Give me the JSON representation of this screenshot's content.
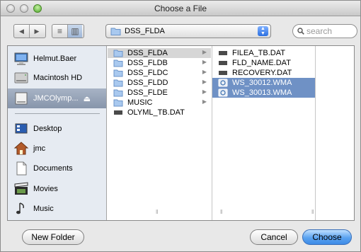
{
  "window": {
    "title": "Choose a File"
  },
  "toolbar": {
    "back_arrow": "◀",
    "forward_arrow": "▶",
    "view_list": "≡",
    "view_columns": "▥",
    "path_label": "DSS_FLDA",
    "search_placeholder": "search"
  },
  "sidebar": {
    "items": [
      {
        "label": "Helmut.Baer",
        "icon": "computer-icon"
      },
      {
        "label": "Macintosh HD",
        "icon": "hard-drive-icon"
      },
      {
        "label": "JMCOlymp...",
        "icon": "drive-icon",
        "eject": "⏏"
      },
      {
        "label": "Desktop",
        "icon": "desktop-icon"
      },
      {
        "label": "jmc",
        "icon": "home-icon"
      },
      {
        "label": "Documents",
        "icon": "documents-icon"
      },
      {
        "label": "Movies",
        "icon": "movies-icon"
      },
      {
        "label": "Music",
        "icon": "music-icon"
      }
    ]
  },
  "columns": {
    "col1": [
      {
        "label": "DSS_FLDA",
        "type": "folder",
        "arrow": "▶"
      },
      {
        "label": "DSS_FLDB",
        "type": "folder",
        "arrow": "▶"
      },
      {
        "label": "DSS_FLDC",
        "type": "folder",
        "arrow": "▶"
      },
      {
        "label": "DSS_FLDD",
        "type": "folder",
        "arrow": "▶"
      },
      {
        "label": "DSS_FLDE",
        "type": "folder",
        "arrow": "▶"
      },
      {
        "label": "MUSIC",
        "type": "folder",
        "arrow": "▶"
      },
      {
        "label": "OLYML_TB.DAT",
        "type": "file"
      }
    ],
    "col2": [
      {
        "label": "FILEA_TB.DAT",
        "type": "file"
      },
      {
        "label": "FLD_NAME.DAT",
        "type": "file"
      },
      {
        "label": "RECOVERY.DAT",
        "type": "file"
      },
      {
        "label": "WS_30012.WMA",
        "type": "audio"
      },
      {
        "label": "WS_30013.WMA",
        "type": "audio"
      }
    ]
  },
  "buttons": {
    "new_folder": "New Folder",
    "cancel": "Cancel",
    "choose": "Choose"
  },
  "colors": {
    "selection_blue": "#6f91c5",
    "selection_gray": "#d6d6d6",
    "sidebar_bg": "#e6ebf2",
    "default_button": "#5aa2f0"
  }
}
